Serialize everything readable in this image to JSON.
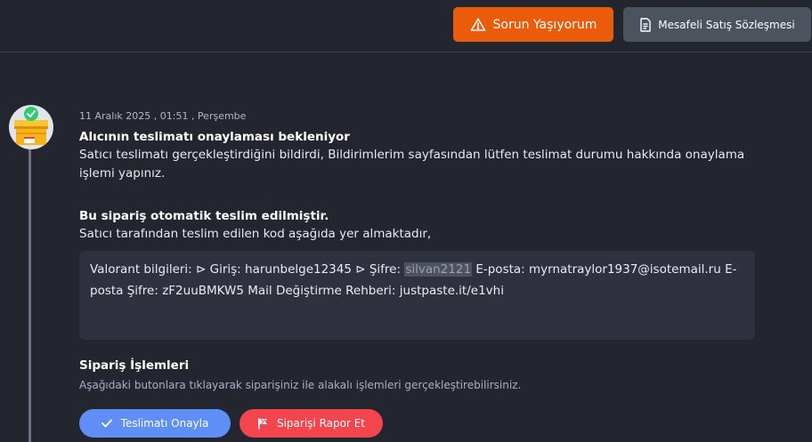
{
  "header": {
    "problem_button_label": "Sorun Yaşıyorum",
    "contract_button_label": "Mesafeli Satış Sözleşmesi"
  },
  "order_event": {
    "date": "11 Aralık 2025 , 01:51 , Perşembe",
    "status_title": "Alıcının teslimatı onaylaması bekleniyor",
    "status_text": "Satıcı teslimatı gerçekleştirdiğini bildirdi, Bildirimlerim sayfasından lütfen teslimat durumu hakkında onaylama işlemi yapınız.",
    "auto_delivery_title": "Bu sipariş otomatik teslim edilmiştir.",
    "auto_delivery_text": "Satıcı tarafından teslim edilen kod aşağıda yer almaktadır,"
  },
  "delivered_code": {
    "part_before": "Valorant bilgileri: ⊳ Giriş: harunbelge12345 ⊳ Şifre: ",
    "highlight": "silvan2121",
    "part_after": " E-posta: myrnatraylor1937@isotemail.ru E-posta Şifre: zF2uuBMKW5 Mail Değiştirme Rehberi: justpaste.it/e1vhi"
  },
  "operations": {
    "title": "Sipariş İşlemleri",
    "subtitle": "Aşağıdaki butonlara tıklayarak siparişiniz ile alakalı işlemleri gerçekleştirebilirsiniz.",
    "confirm_label": "Teslimatı Onayla",
    "report_label": "Siparişi Rapor Et"
  },
  "icons": {
    "problem": "warning-icon",
    "contract": "document-icon",
    "confirm": "check-icon",
    "report": "flag-icon",
    "avatar": "delivery-box-icon"
  },
  "colors": {
    "background": "#23252f",
    "problem_button": "#ea5b0c",
    "contract_button": "#4c535f",
    "confirm_button": "#5f8ff5",
    "report_button": "#f2454d",
    "code_box": "#2f323e"
  }
}
